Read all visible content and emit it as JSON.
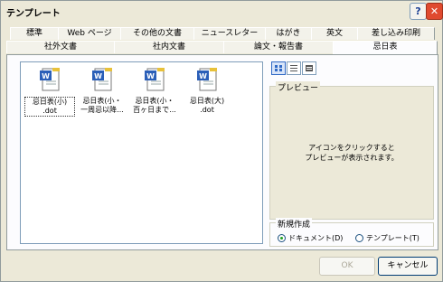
{
  "window": {
    "title": "テンプレート"
  },
  "tabs_row1": [
    {
      "label": "標準"
    },
    {
      "label": "Web ページ"
    },
    {
      "label": "その他の文書"
    },
    {
      "label": "ニュースレター"
    },
    {
      "label": "はがき"
    },
    {
      "label": "英文"
    },
    {
      "label": "差し込み印刷"
    }
  ],
  "tabs_row2": [
    {
      "label": "社外文書"
    },
    {
      "label": "社内文書"
    },
    {
      "label": "論文・報告書"
    },
    {
      "label": "忌日表",
      "active": true
    }
  ],
  "files": [
    {
      "label_line1": "忌日表(小)",
      "label_line2": ".dot",
      "icon": "word-template-icon",
      "selected": true
    },
    {
      "label_line1": "忌日表(小・",
      "label_line2": "一周忌以降...",
      "icon": "word-template-icon"
    },
    {
      "label_line1": "忌日表(小・",
      "label_line2": "百ヶ日まで...",
      "icon": "word-template-icon"
    },
    {
      "label_line1": "忌日表(大)",
      "label_line2": ".dot",
      "icon": "word-template-icon"
    }
  ],
  "views": [
    {
      "name": "large-icons-view",
      "active": true
    },
    {
      "name": "list-view"
    },
    {
      "name": "details-view"
    }
  ],
  "preview": {
    "legend": "プレビュー",
    "line1": "アイコンをクリックすると",
    "line2": "プレビューが表示されます。"
  },
  "new_group": {
    "legend": "新規作成",
    "document": "ドキュメント(D)",
    "template": "テンプレート(T)",
    "selected": "document"
  },
  "buttons": {
    "ok": "OK",
    "cancel": "キャンセル"
  },
  "colors": {
    "accent": "#316ac5",
    "word_blue": "#2b5fb8"
  }
}
